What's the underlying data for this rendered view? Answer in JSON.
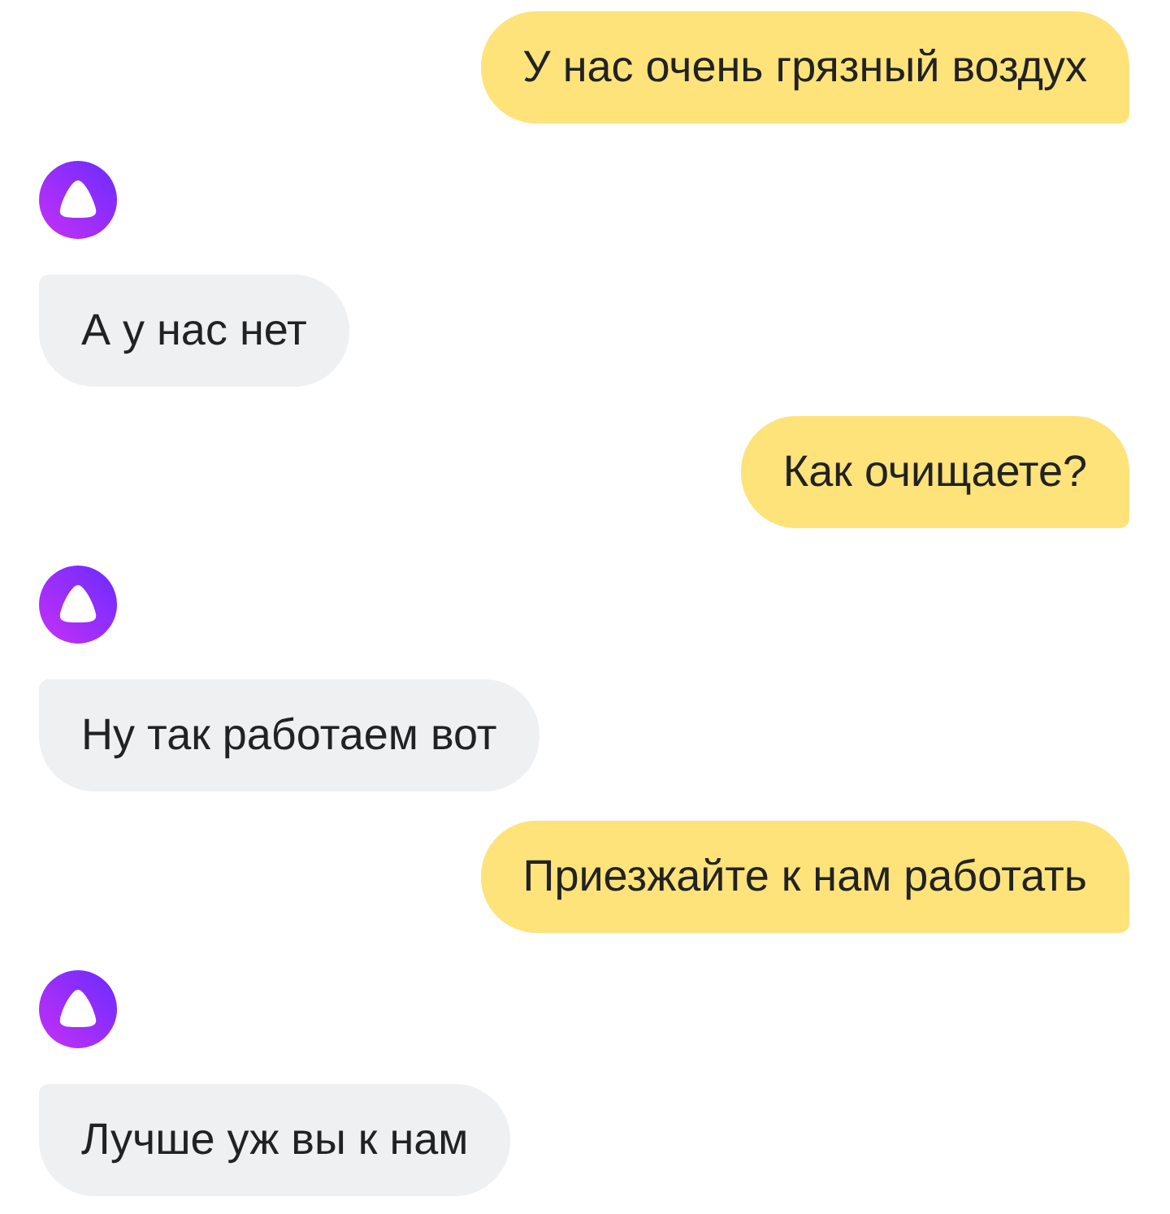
{
  "messages": [
    {
      "kind": "user",
      "text": "У нас очень грязный воздух"
    },
    {
      "kind": "bot",
      "text": "А у нас нет"
    },
    {
      "kind": "user",
      "text": "Как очищаете?"
    },
    {
      "kind": "bot",
      "text": "Ну так работаем вот"
    },
    {
      "kind": "user",
      "text": "Приезжайте к нам работать"
    },
    {
      "kind": "bot",
      "text": "Лучше уж вы к нам"
    }
  ]
}
